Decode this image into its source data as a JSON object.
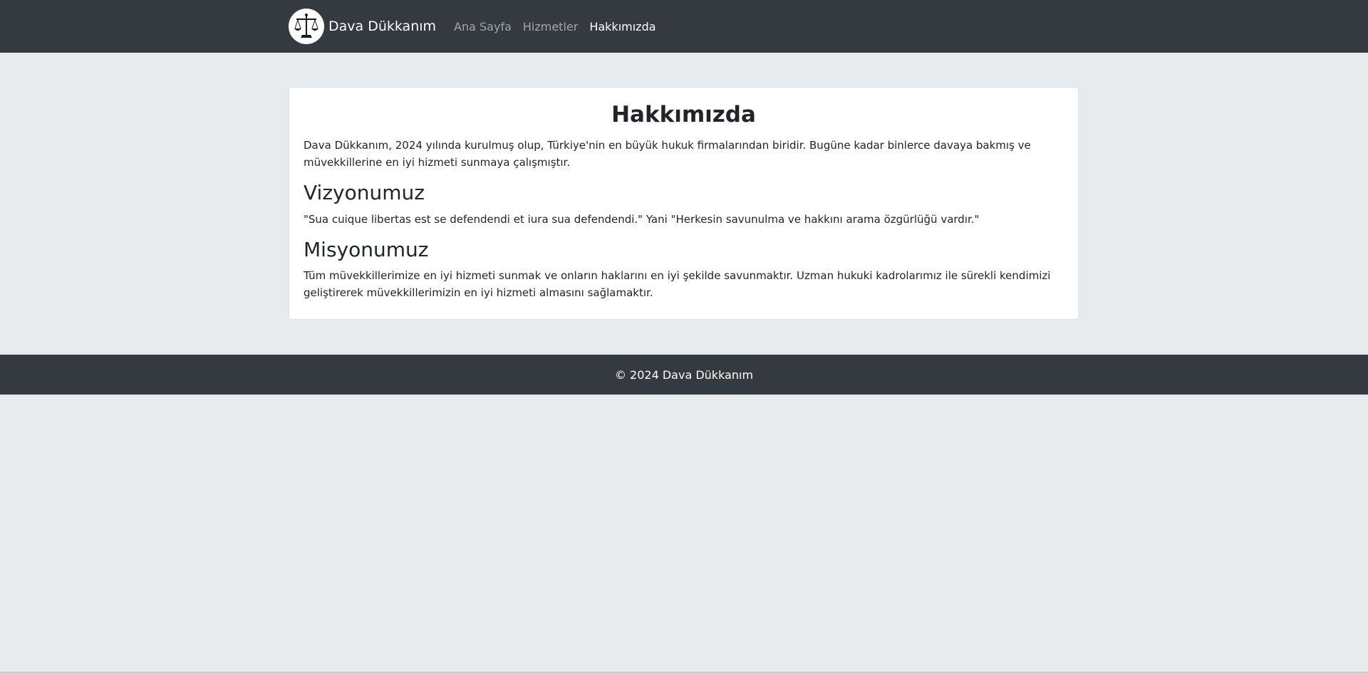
{
  "navbar": {
    "brand": "Dava Dükkanım",
    "logo_icon": "scales-of-justice-icon",
    "links": [
      {
        "label": "Ana Sayfa",
        "active": false
      },
      {
        "label": "Hizmetler",
        "active": false
      },
      {
        "label": "Hakkımızda",
        "active": true
      }
    ]
  },
  "about": {
    "title": "Hakkımızda",
    "intro": "Dava Dükkanım, 2024 yılında kurulmuş olup, Türkiye'nin en büyük hukuk firmalarından biridir. Bugüne kadar binlerce davaya bakmış ve müvekkillerine en iyi hizmeti sunmaya çalışmıştır.",
    "vision_heading": "Vizyonumuz",
    "vision_text": "\"Sua cuique libertas est se defendendi et iura sua defendendi.\" Yani \"Herkesin savunulma ve hakkını arama özgürlüğü vardır.\"",
    "mission_heading": "Misyonumuz",
    "mission_text": "Tüm müvekkillerimize en iyi hizmeti sunmak ve onların haklarını en iyi şekilde savunmaktır. Uzman hukuki kadrolarımız ile sürekli kendimizi geliştirerek müvekkillerimizin en iyi hizmeti almasını sağlamaktır."
  },
  "footer": {
    "text": "© 2024 Dava Dükkanım"
  },
  "colors": {
    "navbar_bg": "#343a40",
    "page_bg": "#e8ebee",
    "card_bg": "#ffffff",
    "active_link": "#ffffff",
    "inactive_link": "#9a9da0"
  }
}
